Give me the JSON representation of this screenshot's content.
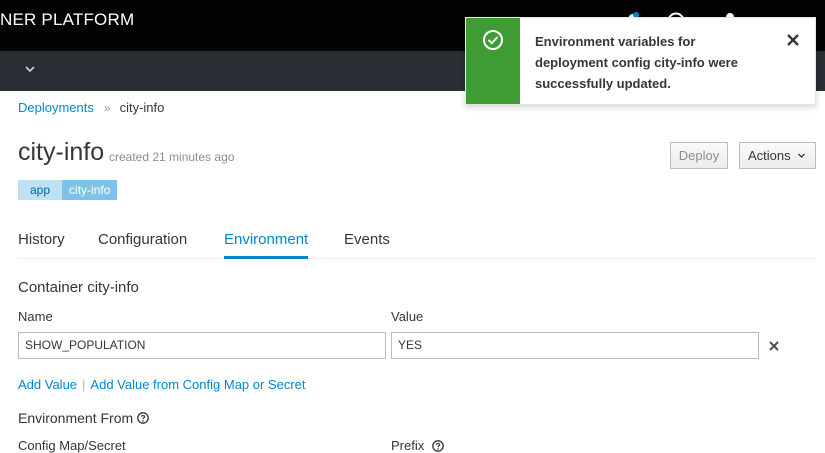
{
  "masthead": {
    "brand": "NER PLATFORM",
    "icons": [
      "notifications-icon",
      "help-icon",
      "user-icon"
    ]
  },
  "project_bar": {
    "icon": "chevron-down-icon"
  },
  "breadcrumb": {
    "parent": "Deployments",
    "separator": "»",
    "current": "city-info"
  },
  "header": {
    "title": "city-info",
    "subtitle": "created 21 minutes ago",
    "deploy_label": "Deploy",
    "actions_label": "Actions"
  },
  "labels": [
    {
      "key": "app",
      "value": "city-info"
    }
  ],
  "tabs": [
    {
      "label": "History",
      "active": false
    },
    {
      "label": "Configuration",
      "active": false
    },
    {
      "label": "Environment",
      "active": true
    },
    {
      "label": "Events",
      "active": false
    }
  ],
  "container": {
    "title": "Container city-info",
    "name_header": "Name",
    "value_header": "Value",
    "rows": [
      {
        "name": "SHOW_POPULATION",
        "value": "YES"
      }
    ],
    "add_value": "Add Value",
    "link_separator": "|",
    "add_from_config": "Add Value from Config Map or Secret"
  },
  "environment_from": {
    "title": "Environment From",
    "config_header": "Config Map/Secret",
    "prefix_header": "Prefix"
  },
  "toast": {
    "message": "Environment variables for deployment config city-info were successfully updated.",
    "status_icon": "check-circle-icon",
    "close_icon": "close-icon",
    "accent": "#3f9c35"
  },
  "colors": {
    "link": "#0088ce",
    "masthead": "#030303",
    "project_bar": "#292e34",
    "success": "#3f9c35"
  }
}
